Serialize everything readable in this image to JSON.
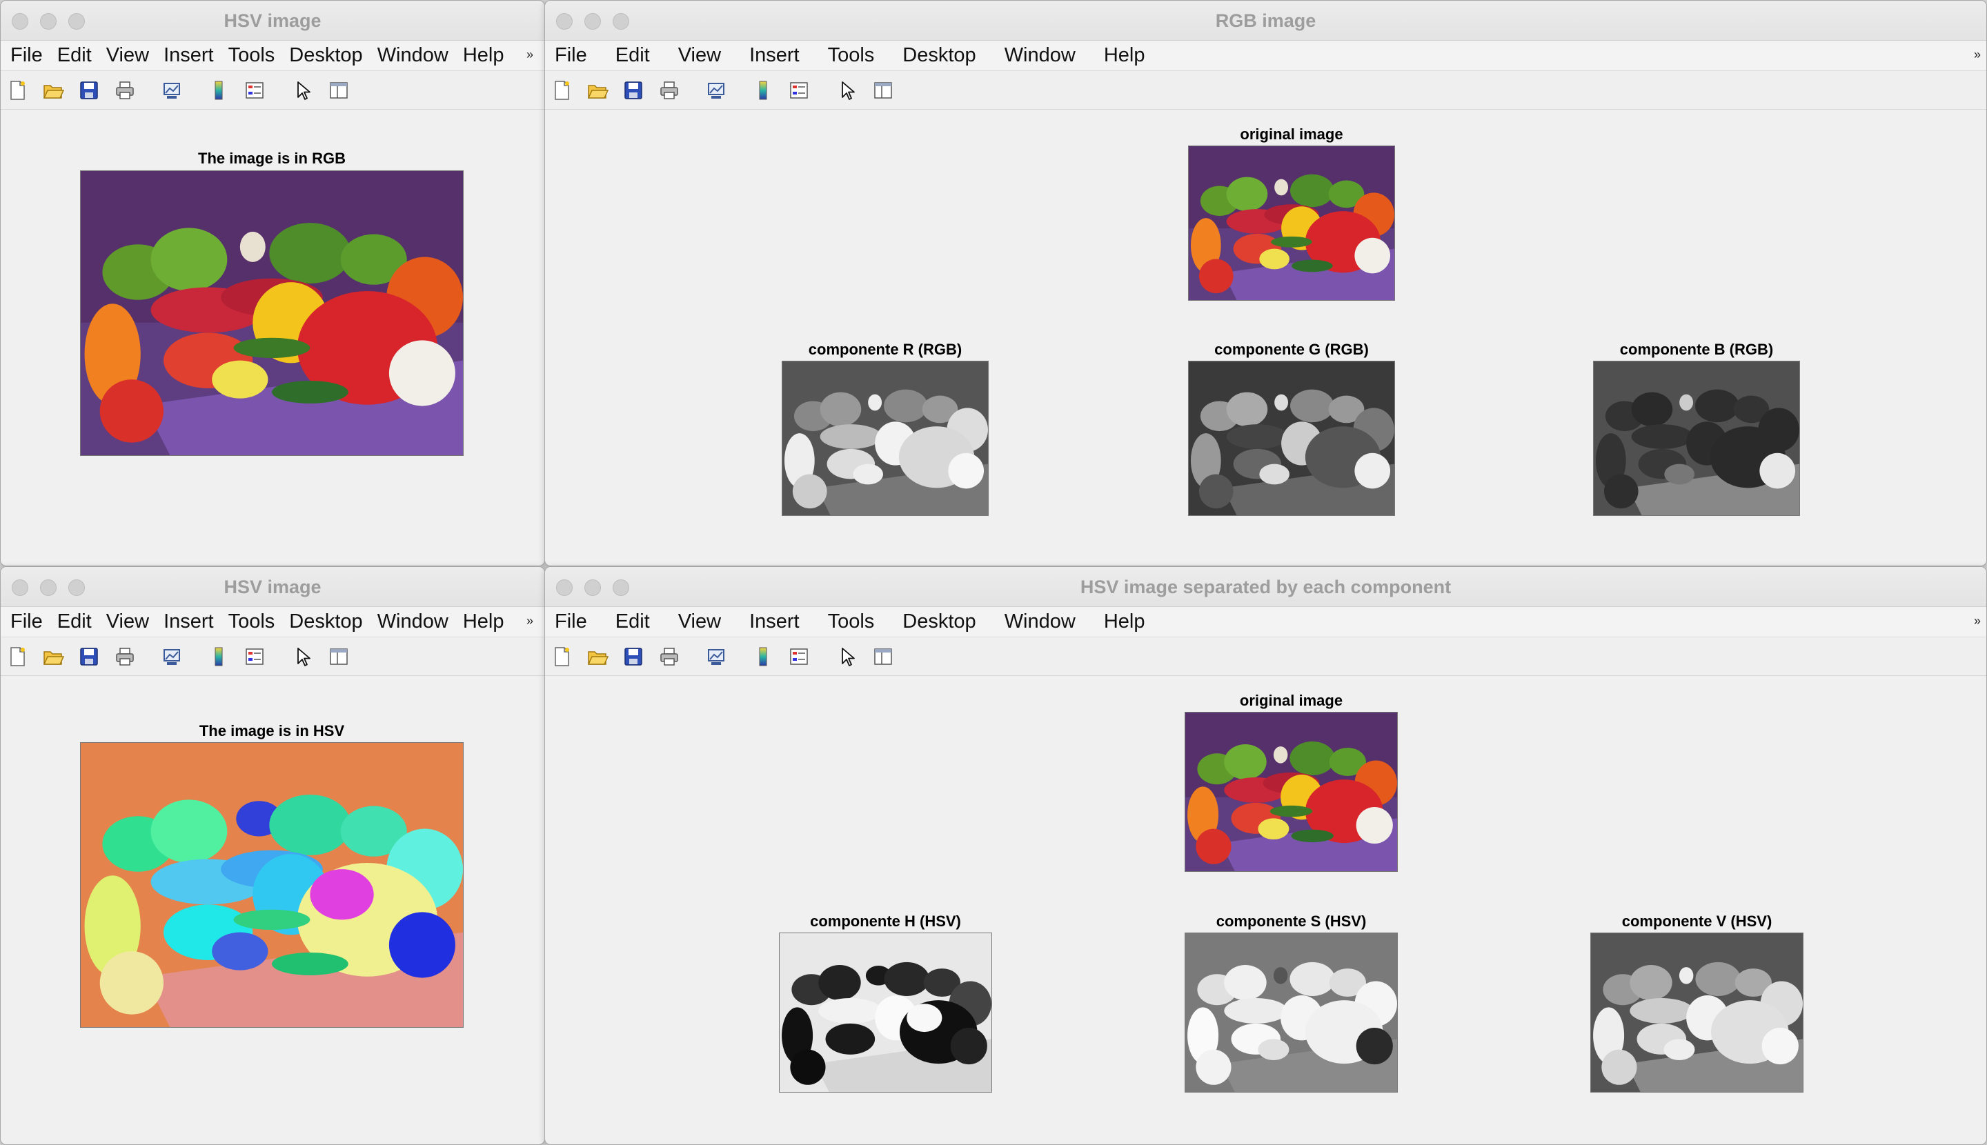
{
  "menu": [
    "File",
    "Edit",
    "View",
    "Insert",
    "Tools",
    "Desktop",
    "Window",
    "Help"
  ],
  "menu_overflow": "»",
  "toolbar_icons": [
    "new-figure-icon",
    "open-file-icon",
    "save-icon",
    "print-icon",
    "link-plot-icon",
    "insert-colorbar-icon",
    "insert-legend-icon",
    "edit-plot-icon",
    "property-inspector-icon"
  ],
  "windows": {
    "hsv_top": {
      "title": "HSV image",
      "axes_title": "The image is in RGB"
    },
    "rgb": {
      "title": "RGB image",
      "original_title": "original image",
      "components": [
        "componente R (RGB)",
        "componente G (RGB)",
        "componente B (RGB)"
      ]
    },
    "hsv_bottom": {
      "title": "HSV image",
      "axes_title": "The image is in HSV"
    },
    "hsv_components": {
      "title": "HSV image separated by each component",
      "original_title": "original image",
      "components": [
        "componente H (HSV)",
        "componente S (HSV)",
        "componente V (HSV)"
      ]
    }
  },
  "colors": {
    "window_bg": "#f0f0f0",
    "title_text": "#9d9d9d",
    "background_cloth": "#5a2f6a",
    "table_cloth": "#7a50a8",
    "hsv_background": "#e98a4a"
  }
}
